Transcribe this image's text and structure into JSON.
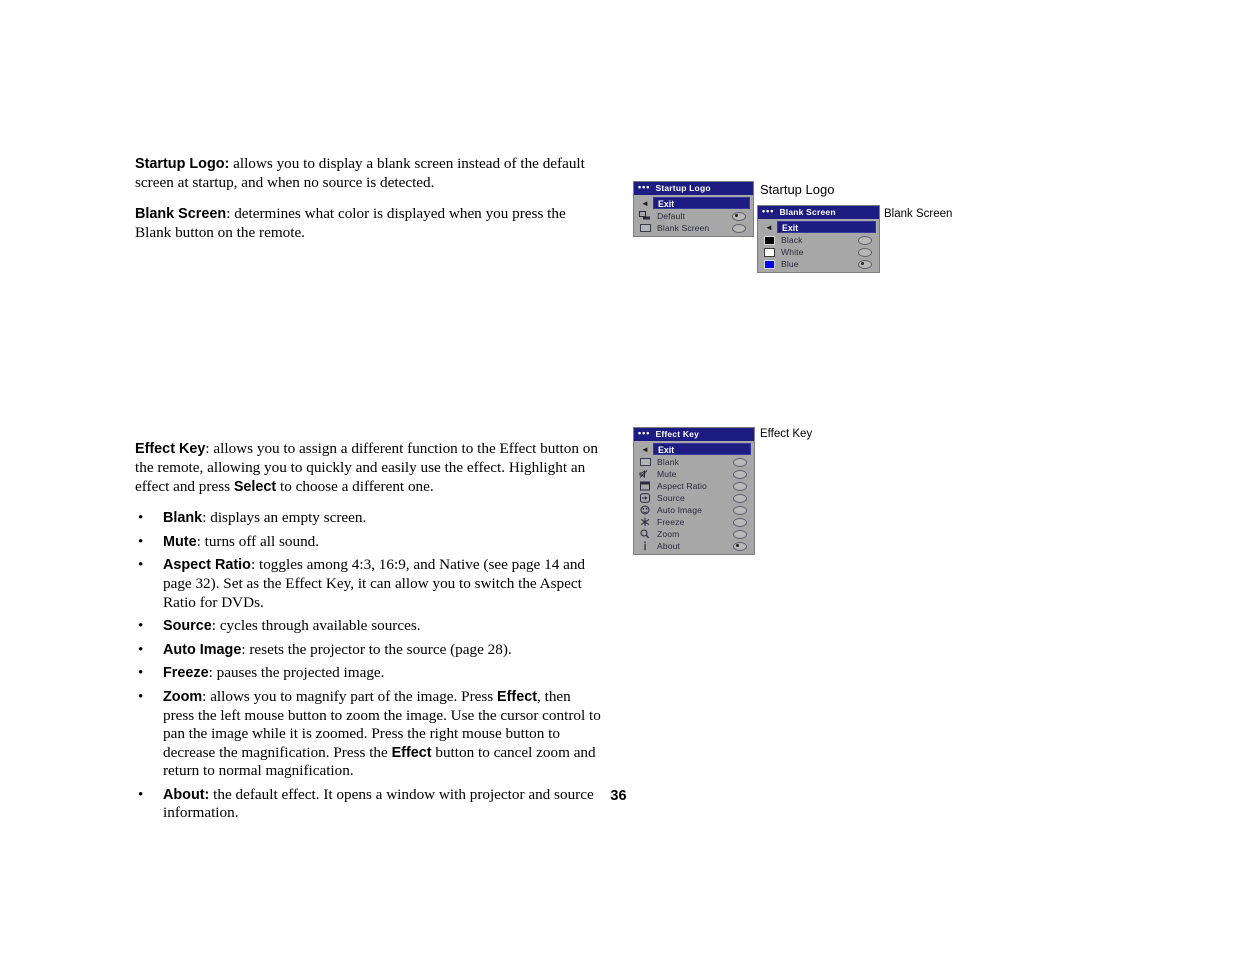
{
  "page": {
    "number": "36"
  },
  "body": {
    "paragraphs": [
      {
        "id": "startup-logo",
        "lead": "Startup Logo:",
        "rest": " allows you to display a blank screen instead of the default screen at startup, and when no source is detected."
      },
      {
        "id": "blank-screen",
        "lead": "Blank Screen",
        "rest": ": determines what color is displayed when you press the Blank button on the remote."
      }
    ],
    "effect_key": {
      "lead": "Effect Key",
      "part1": ": allows you to assign a different function to the Effect button on the remote, allowing you to quickly and easily use the effect. Highlight an effect and press ",
      "bold2": "Select",
      "part2": " to choose a different one."
    },
    "bullets": [
      {
        "lead": "Blank",
        "rest": ": displays an empty screen."
      },
      {
        "lead": "Mute",
        "rest": ": turns off all sound."
      },
      {
        "lead": "Aspect Ratio",
        "rest": ": toggles among 4:3, 16:9, and Native (see page 14 and page 32). Set as the Effect Key, it can allow you to switch the Aspect Ratio for DVDs."
      },
      {
        "lead": "Source",
        "rest": ": cycles through available sources."
      },
      {
        "lead": "Auto Image",
        "rest": ": resets the projector to the source (page 28)."
      },
      {
        "lead": "Freeze",
        "rest": ": pauses the projected image."
      },
      {
        "lead": "Zoom",
        "rest_a": ": allows you to magnify part of the image. Press ",
        "bold_a": "Effect",
        "rest_b": ", then press the left mouse button to zoom the image. Use the cursor control to pan the image while it is zoomed. Press the right mouse button to decrease the magnification. Press the ",
        "bold_b": "Effect",
        "rest_c": " button to cancel zoom and return to normal magnification."
      },
      {
        "lead": "About:",
        "rest": " the default effect. It opens a window with projector and source information."
      }
    ]
  },
  "menus": {
    "startup_logo": {
      "title": "Startup Logo",
      "caption": "Startup Logo",
      "exit": "Exit",
      "items": [
        {
          "label": "Default",
          "icon": "projector-icon",
          "selected": true
        },
        {
          "label": "Blank Screen",
          "icon": "blank-rect-icon",
          "selected": false
        }
      ]
    },
    "blank_screen": {
      "title": "Blank Screen",
      "caption": "Blank Screen",
      "exit": "Exit",
      "items": [
        {
          "label": "Black",
          "icon": "black-swatch-icon",
          "selected": false,
          "color": "#000000"
        },
        {
          "label": "White",
          "icon": "white-swatch-icon",
          "selected": false,
          "color": "#ffffff"
        },
        {
          "label": "Blue",
          "icon": "blue-swatch-icon",
          "selected": true,
          "color": "#0000f0"
        }
      ]
    },
    "effect_key": {
      "title": "Effect Key",
      "caption": "Effect Key",
      "exit": "Exit",
      "items": [
        {
          "label": "Blank",
          "icon": "blank-rect-icon",
          "selected": false
        },
        {
          "label": "Mute",
          "icon": "mute-speaker-icon",
          "selected": false
        },
        {
          "label": "Aspect Ratio",
          "icon": "aspect-ratio-icon",
          "selected": false
        },
        {
          "label": "Source",
          "icon": "source-arrow-icon",
          "selected": false
        },
        {
          "label": "Auto Image",
          "icon": "auto-image-icon",
          "selected": false
        },
        {
          "label": "Freeze",
          "icon": "freeze-snowflake-icon",
          "selected": false
        },
        {
          "label": "Zoom",
          "icon": "zoom-magnifier-icon",
          "selected": false
        },
        {
          "label": "About",
          "icon": "about-info-icon",
          "selected": true
        }
      ]
    }
  },
  "colors": {
    "osd_title_bar": "#1c1c82",
    "osd_body": "#a7a7a7",
    "highlight": "#1c1c82"
  }
}
